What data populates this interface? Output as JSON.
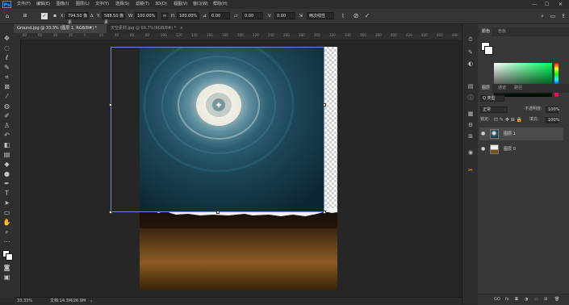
{
  "menu": {
    "logo": "Ps",
    "items": [
      "文件(F)",
      "编辑(E)",
      "图像(I)",
      "图层(L)",
      "文字(Y)",
      "选择(S)",
      "滤镜(T)",
      "3D(D)",
      "视图(V)",
      "窗口(W)",
      "帮助(H)"
    ],
    "minimize": "—",
    "maximize": "☐",
    "close": "✕"
  },
  "options": {
    "x_label": "X:",
    "x_value": "794.50 像素",
    "y_label": "Y:",
    "y_value": "588.50 像素",
    "w_label": "W:",
    "w_value": "100.00%",
    "h_label": "H:",
    "h_value": "100.00%",
    "angle_value": "0.00",
    "skew_h_value": "0.00",
    "v_label": "V:",
    "skew_v_value": "0.00",
    "interp_value": "两次线性"
  },
  "tabs": [
    {
      "label": "Ground.jpg @ 33.3% (图层 1, RGB/8#) *",
      "close": "×"
    },
    {
      "label": "天空素材.jpg @ 60.7%(RGB/8#) *",
      "close": "×"
    }
  ],
  "ruler_top_labels": [
    "80",
    "60",
    "40",
    "20",
    "0",
    "20",
    "40",
    "60",
    "80",
    "100",
    "120",
    "140",
    "160",
    "180",
    "200",
    "220",
    "240",
    "260",
    "280",
    "300",
    "320",
    "340",
    "360",
    "380",
    "400",
    "420",
    "440",
    "460",
    "480"
  ],
  "status": {
    "zoom": "33.33%",
    "doc": "文档:14.3M/26.9M",
    "arrow": "›"
  },
  "panels": {
    "color_tabs": [
      "颜色",
      "色板"
    ],
    "layer_tabs": [
      "图层",
      "通道",
      "路径"
    ],
    "filter_kind": "Q 类型",
    "blend_mode": "正常",
    "opacity_label": "不透明度:",
    "opacity_value": "100%",
    "lock_label": "锁定:",
    "fill_label": "填充:",
    "fill_value": "100%",
    "layers": [
      {
        "name": "图层 1",
        "selected": true,
        "eye": "●"
      },
      {
        "name": "图层 0",
        "selected": false,
        "eye": "●"
      }
    ],
    "bottom_icons": [
      "GO",
      "fx",
      "◘",
      "◑",
      "▭",
      "⊞",
      "🗑"
    ]
  },
  "colors": {
    "accent": "#31a8ff",
    "selected_layer": "#4b4b4b"
  }
}
